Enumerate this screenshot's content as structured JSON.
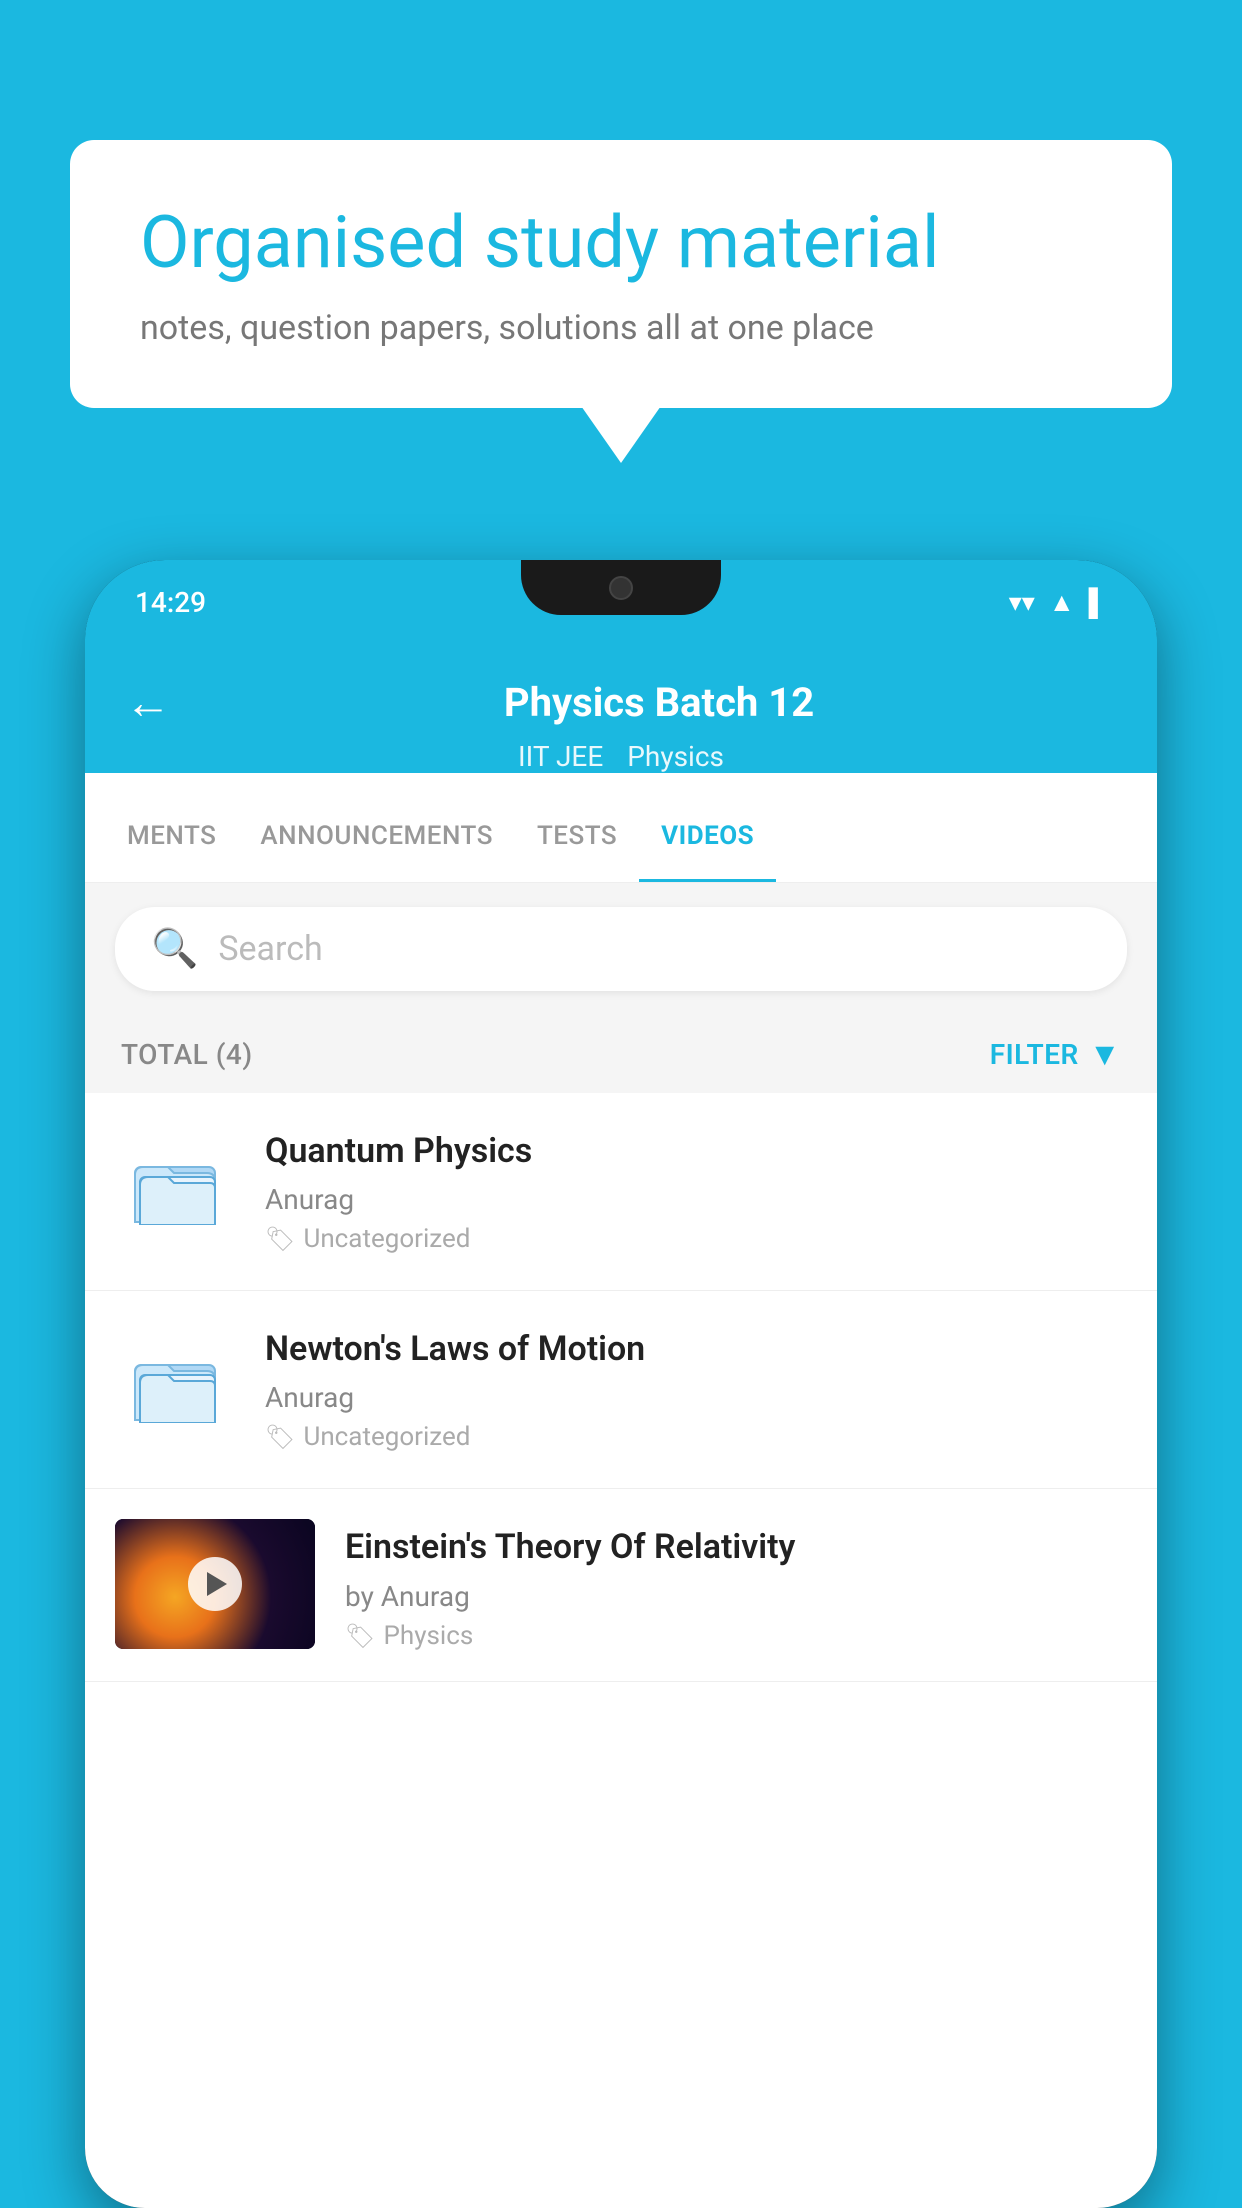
{
  "page": {
    "background_color": "#1bb8e0"
  },
  "speech_bubble": {
    "title": "Organised study material",
    "subtitle": "notes, question papers, solutions all at one place"
  },
  "phone": {
    "status_bar": {
      "time": "14:29"
    },
    "header": {
      "back_label": "←",
      "title": "Physics Batch 12",
      "tag1": "IIT JEE",
      "tag2": "Physics"
    },
    "tabs": [
      {
        "label": "MENTS",
        "active": false
      },
      {
        "label": "ANNOUNCEMENTS",
        "active": false
      },
      {
        "label": "TESTS",
        "active": false
      },
      {
        "label": "VIDEOS",
        "active": true
      }
    ],
    "search": {
      "placeholder": "Search"
    },
    "filter": {
      "total_label": "TOTAL (4)",
      "filter_label": "FILTER"
    },
    "videos": [
      {
        "title": "Quantum Physics",
        "author": "Anurag",
        "tag": "Uncategorized",
        "has_thumbnail": false
      },
      {
        "title": "Newton's Laws of Motion",
        "author": "Anurag",
        "tag": "Uncategorized",
        "has_thumbnail": false
      },
      {
        "title": "Einstein's Theory Of Relativity",
        "author": "by Anurag",
        "tag": "Physics",
        "has_thumbnail": true
      }
    ]
  }
}
